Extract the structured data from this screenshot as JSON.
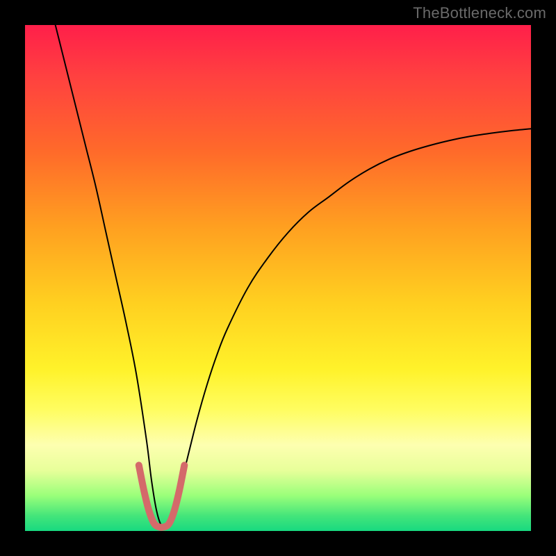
{
  "watermark": "TheBottleneck.com",
  "chart_data": {
    "type": "line",
    "title": "",
    "xlabel": "",
    "ylabel": "",
    "xlim": [
      0,
      100
    ],
    "ylim": [
      0,
      100
    ],
    "grid": false,
    "legend": false,
    "annotations": [],
    "background_gradient_stops": [
      {
        "pos": 0,
        "color": "#ff1f4a"
      },
      {
        "pos": 25,
        "color": "#ff6a2a"
      },
      {
        "pos": 55,
        "color": "#ffd020"
      },
      {
        "pos": 76,
        "color": "#fffd60"
      },
      {
        "pos": 93,
        "color": "#9aff7a"
      },
      {
        "pos": 100,
        "color": "#18d980"
      }
    ],
    "series": [
      {
        "name": "bottleneck-curve",
        "color": "#000000",
        "stroke_width": 2,
        "x": [
          6,
          8,
          10,
          12,
          14,
          16,
          18,
          20,
          22,
          24,
          25,
          26,
          27,
          28,
          29,
          30,
          32,
          34,
          36,
          38,
          40,
          44,
          48,
          52,
          56,
          60,
          64,
          68,
          72,
          76,
          80,
          84,
          88,
          92,
          96,
          100
        ],
        "values": [
          100,
          92,
          84,
          76,
          68,
          59,
          50,
          41,
          31,
          18,
          10,
          4,
          1,
          1,
          2,
          6,
          14,
          22,
          29,
          35,
          40,
          48,
          54,
          59,
          63,
          66,
          69,
          71.5,
          73.5,
          75,
          76.2,
          77.2,
          78,
          78.6,
          79.1,
          79.5
        ]
      },
      {
        "name": "highlight-band",
        "color": "#d46a6a",
        "stroke_width": 10,
        "x": [
          22.5,
          23.5,
          24.5,
          25.5,
          26.5,
          27.5,
          28.5,
          29.5,
          30.5,
          31.5
        ],
        "values": [
          13,
          8,
          4,
          1.5,
          0.8,
          0.8,
          1.5,
          4,
          8,
          13
        ]
      }
    ]
  }
}
